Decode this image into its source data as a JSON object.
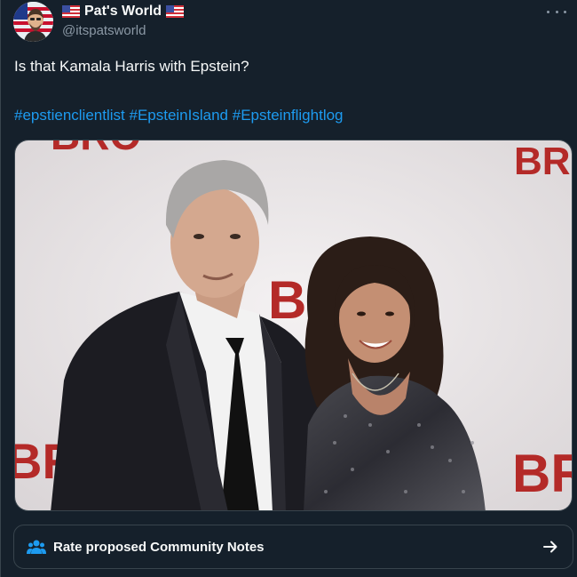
{
  "header": {
    "display_name": "Pat's World",
    "handle": "@itspatsworld",
    "left_flag_icon": "us-flag-icon",
    "right_flag_icon": "us-flag-icon",
    "more_icon": "more-horizontal-icon"
  },
  "tweet": {
    "text": "Is that Kamala Harris with Epstein?",
    "hashtags": [
      "#epstienclientlist",
      "#EpsteinIsland",
      "#Epsteinflightlog"
    ]
  },
  "media": {
    "backdrop_text_left": "BRO",
    "backdrop_text_right": "BR",
    "backdrop_text_top": "BRO",
    "backdrop_text_center": "BRO"
  },
  "community_notes": {
    "label": "Rate proposed Community Notes",
    "icon": "people-icon",
    "arrow_icon": "arrow-right-icon"
  },
  "colors": {
    "background": "#15202b",
    "link": "#1d9bf0",
    "muted": "#8b98a5",
    "border": "#38444d"
  }
}
